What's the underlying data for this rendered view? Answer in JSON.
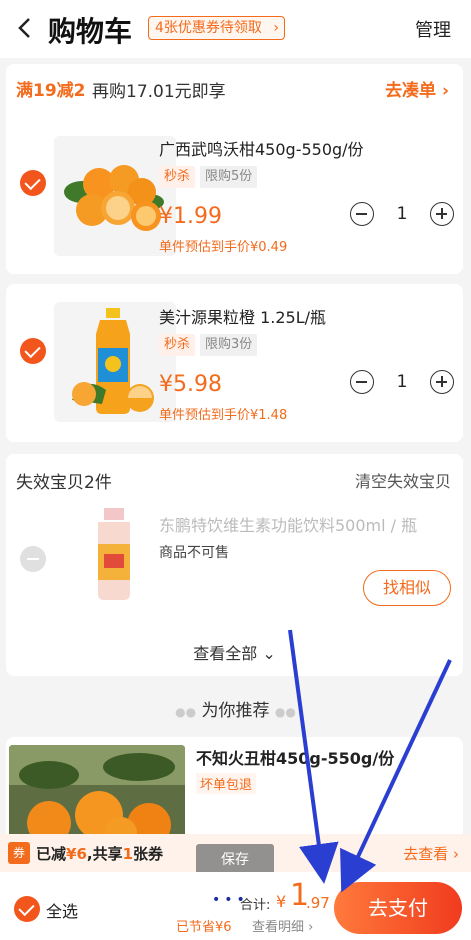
{
  "header": {
    "title": "购物车",
    "coupon_pill": "4张优惠券待领取",
    "manage": "管理"
  },
  "promo": {
    "tag": "满19减2",
    "text": "再购17.01元即享",
    "link": "去凑单"
  },
  "items": [
    {
      "name": "广西武鸣沃柑450g-550g/份",
      "badge_sale": "秒杀",
      "badge_limit": "限购5份",
      "price": "¥1.99",
      "estimate": "单件预估到手价¥0.49",
      "qty": "1"
    },
    {
      "name": "美汁源果粒橙 1.25L/瓶",
      "badge_sale": "秒杀",
      "badge_limit": "限购3份",
      "price": "¥5.98",
      "estimate": "单件预估到手价¥1.48",
      "qty": "1"
    }
  ],
  "invalid": {
    "header": "失效宝贝2件",
    "clear": "清空失效宝贝",
    "item_name": "东鹏特饮维生素功能饮料500ml / 瓶",
    "item_state": "商品不可售",
    "similar_button": "找相似",
    "view_all": "查看全部"
  },
  "recommend": {
    "title": "为你推荐",
    "item_name": "不知火丑柑450g-550g/份",
    "item_tag": "坏单包退"
  },
  "saved_bar": {
    "quan": "券",
    "prefix": "已减",
    "amount": "¥6",
    "middle": ",共享",
    "count": "1",
    "suffix": "张券",
    "look": "去查看"
  },
  "toast": "保存",
  "footer": {
    "select_all": "全选",
    "total_label": "合计:",
    "currency": "¥",
    "total_int": "1",
    "total_dec": ".97",
    "saved": "已节省¥6",
    "detail": "查看明细",
    "pay_button": "去支付"
  },
  "colors": {
    "accent": "#f36b1c",
    "pay_gradient_start": "#ff7a3c",
    "pay_gradient_end": "#f13b1e",
    "annotation_arrow": "#2a3fd1"
  }
}
